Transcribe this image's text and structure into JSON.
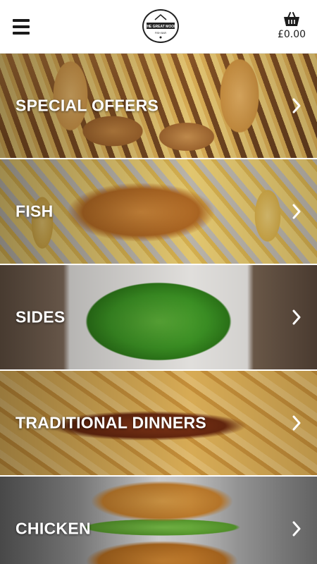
{
  "header": {
    "logo_text_top": "THE GREAT MOOR",
    "logo_text_bottom": "FISH BAR",
    "cart_total": "£0.00"
  },
  "categories": [
    {
      "label": "SPECIAL OFFERS"
    },
    {
      "label": "FISH"
    },
    {
      "label": "SIDES"
    },
    {
      "label": "TRADITIONAL DINNERS"
    },
    {
      "label": "CHICKEN"
    }
  ],
  "colors": {
    "header_bg": "#ffffff",
    "icon": "#1b1b1b",
    "label": "#ffffff"
  },
  "icons": [
    "menu-icon",
    "basket-icon",
    "chevron-right-icon"
  ]
}
